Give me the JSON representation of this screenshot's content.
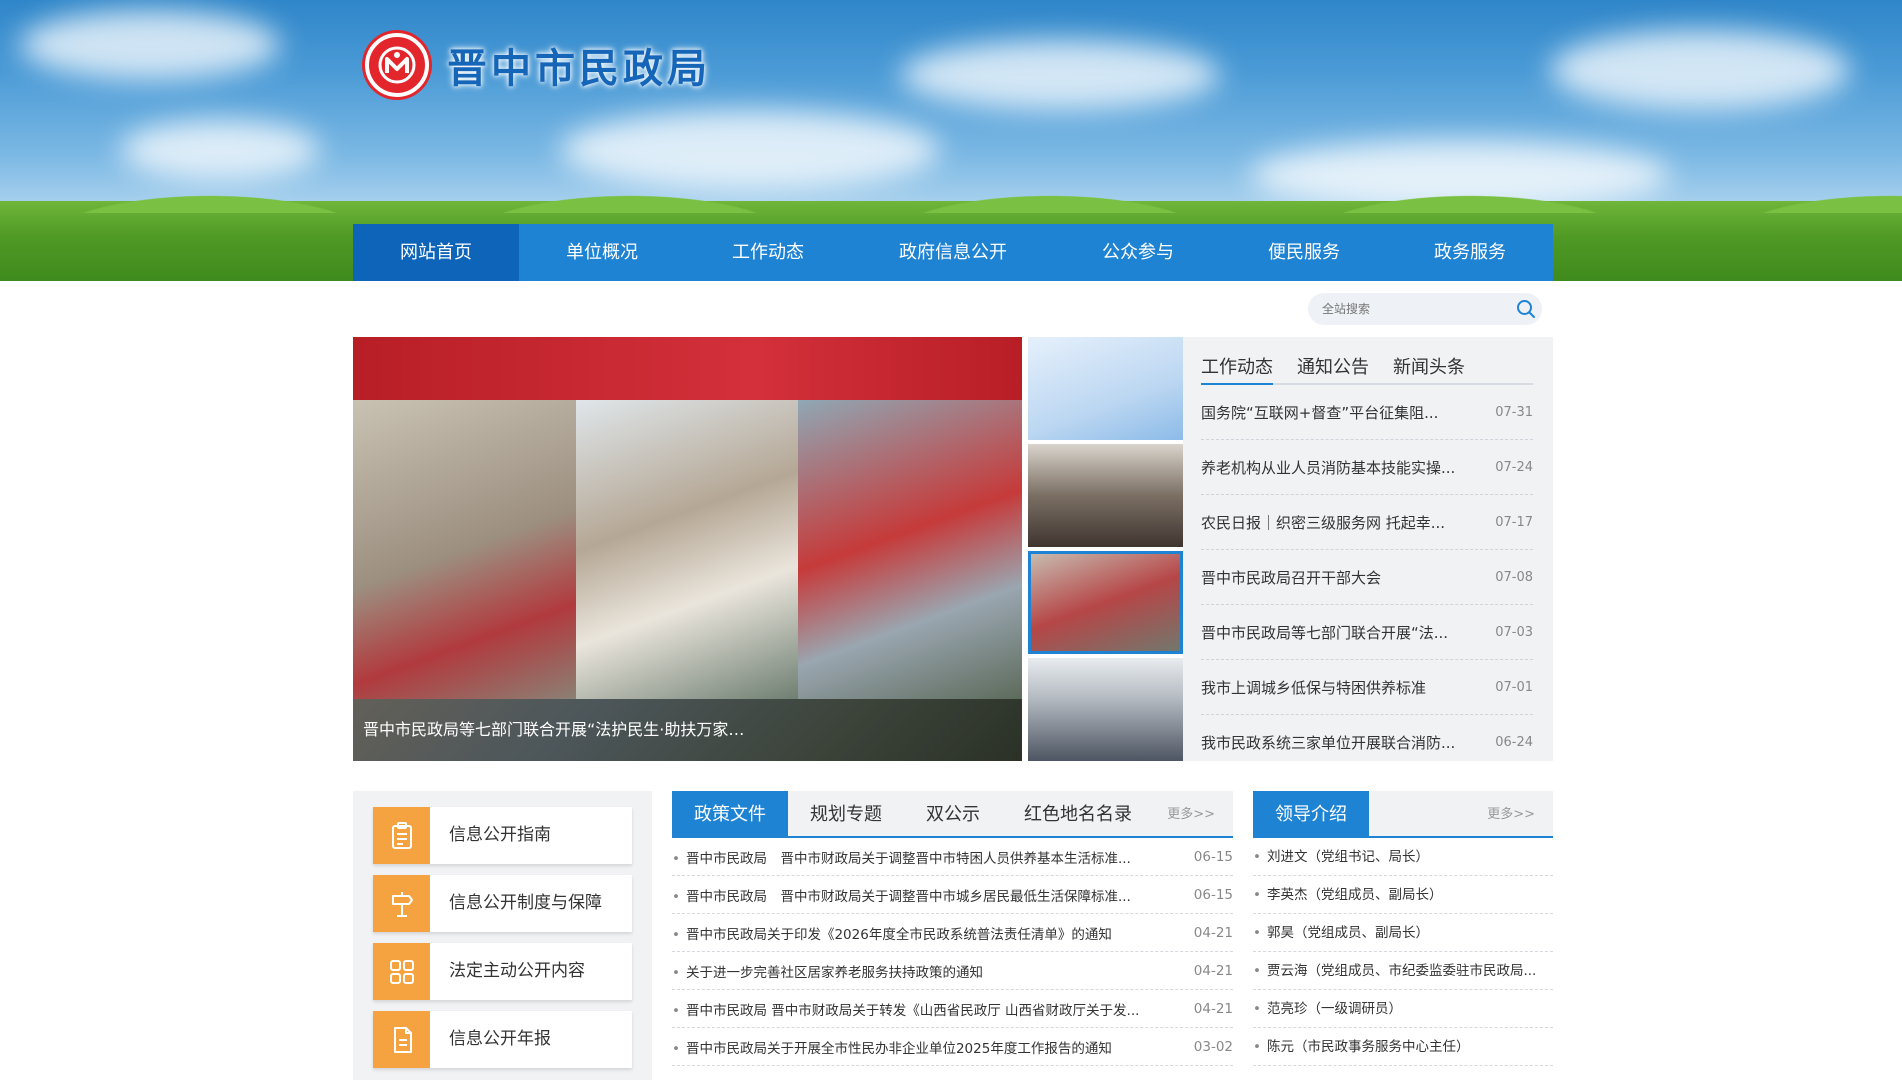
{
  "site": {
    "title": "晋中市民政局",
    "emblem_icon": "civil-affairs-emblem-icon"
  },
  "nav": {
    "items": [
      {
        "label": "网站首页",
        "active": true
      },
      {
        "label": "单位概况"
      },
      {
        "label": "工作动态"
      },
      {
        "label": "政府信息公开"
      },
      {
        "label": "公众参与"
      },
      {
        "label": "便民服务"
      },
      {
        "label": "政务服务"
      }
    ]
  },
  "search": {
    "placeholder": "全站搜索",
    "icon": "search-icon"
  },
  "slider": {
    "caption": "晋中市民政局等七部门联合开展“法护民生·助扶万家…",
    "active_thumb": 2
  },
  "news": {
    "tabs": [
      "工作动态",
      "通知公告",
      "新闻头条"
    ],
    "active_tab": 0,
    "items": [
      {
        "title": "国务院“互联网+督查”平台征集阻...",
        "date": "07-31"
      },
      {
        "title": "养老机构从业人员消防基本技能实操...",
        "date": "07-24"
      },
      {
        "title": "农民日报｜织密三级服务网 托起幸...",
        "date": "07-17"
      },
      {
        "title": "晋中市民政局召开干部大会",
        "date": "07-08"
      },
      {
        "title": "晋中市民政局等七部门联合开展“法...",
        "date": "07-03"
      },
      {
        "title": "我市上调城乡低保与特困供养标准",
        "date": "07-01"
      },
      {
        "title": "我市民政系统三家单位开展联合消防...",
        "date": "06-24"
      }
    ]
  },
  "info": {
    "cards": [
      {
        "label": "信息公开指南",
        "icon": "clipboard-icon"
      },
      {
        "label": "信息公开制度与保障",
        "icon": "signpost-icon"
      },
      {
        "label": "法定主动公开内容",
        "icon": "grid-icon"
      },
      {
        "label": "信息公开年报",
        "icon": "document-icon"
      }
    ]
  },
  "policy": {
    "tabs": [
      "政策文件",
      "规划专题",
      "双公示",
      "红色地名名录"
    ],
    "active_tab": 0,
    "more": "更多>>",
    "items": [
      {
        "title": "晋中市民政局　晋中市财政局关于调整晋中市特困人员供养基本生活标准...",
        "date": "06-15"
      },
      {
        "title": "晋中市民政局　晋中市财政局关于调整晋中市城乡居民最低生活保障标准...",
        "date": "06-15"
      },
      {
        "title": "晋中市民政局关于印发《2026年度全市民政系统普法责任清单》的通知",
        "date": "04-21"
      },
      {
        "title": "关于进一步完善社区居家养老服务扶持政策的通知",
        "date": "04-21"
      },
      {
        "title": "晋中市民政局 晋中市财政局关于转发《山西省民政厅 山西省财政厅关于发...",
        "date": "04-21"
      },
      {
        "title": "晋中市民政局关于开展全市性民办非企业单位2025年度工作报告的通知",
        "date": "03-02"
      }
    ]
  },
  "leaders": {
    "tab": "领导介绍",
    "more": "更多>>",
    "items": [
      "刘进文（党组书记、局长）",
      "李英杰（党组成员、副局长）",
      "郭昊（党组成员、副局长）",
      "贾云海（党组成员、市纪委监委驻市民政局...",
      "范亮珍（一级调研员）",
      "陈元（市民政事务服务中心主任）"
    ]
  },
  "colors": {
    "primary": "#1f83d3",
    "primary_dark": "#0d64b8",
    "accent_orange": "#f4a340",
    "emblem_red": "#e2262b"
  }
}
